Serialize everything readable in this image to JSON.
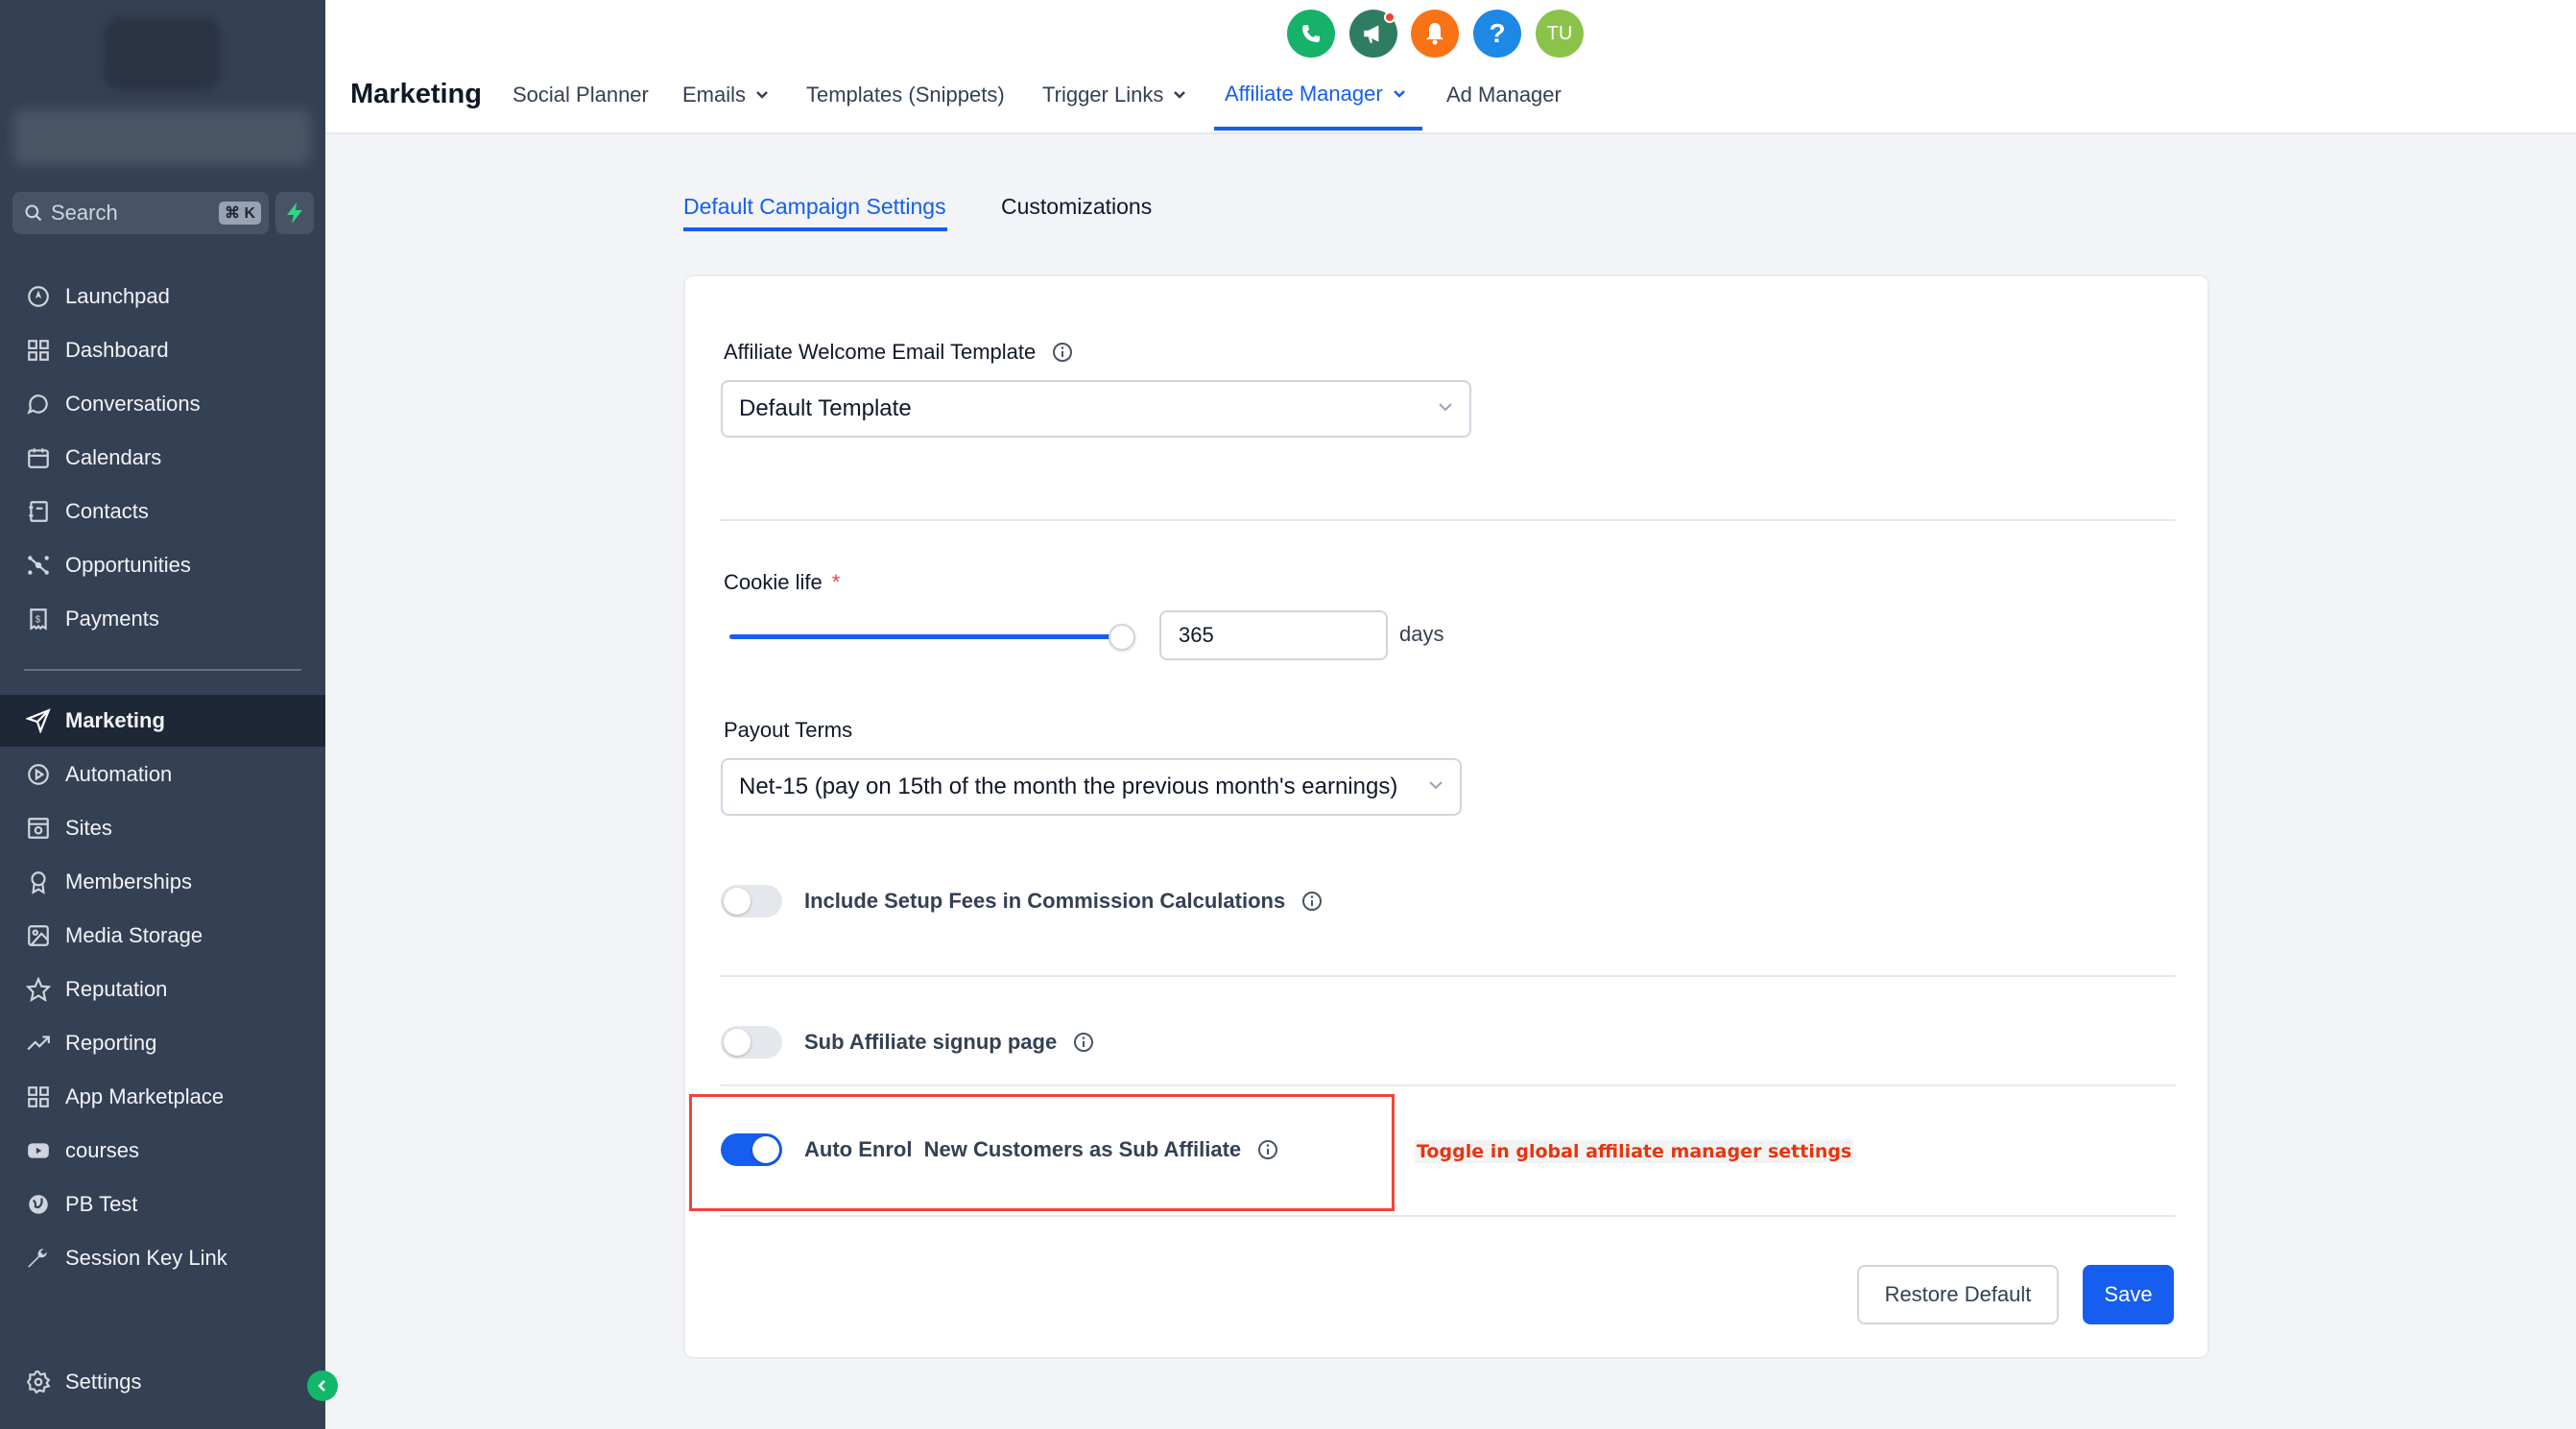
{
  "sidebar": {
    "search_placeholder": "Search",
    "search_shortcut": "⌘ K",
    "items": [
      {
        "label": "Launchpad",
        "icon": "launchpad-icon"
      },
      {
        "label": "Dashboard",
        "icon": "dashboard-icon"
      },
      {
        "label": "Conversations",
        "icon": "chat-icon"
      },
      {
        "label": "Calendars",
        "icon": "calendar-icon"
      },
      {
        "label": "Contacts",
        "icon": "contacts-icon"
      },
      {
        "label": "Opportunities",
        "icon": "opportunities-icon"
      },
      {
        "label": "Payments",
        "icon": "payments-icon"
      },
      {
        "label": "Marketing",
        "icon": "send-icon",
        "active": true
      },
      {
        "label": "Automation",
        "icon": "automation-icon"
      },
      {
        "label": "Sites",
        "icon": "sites-icon"
      },
      {
        "label": "Memberships",
        "icon": "award-icon"
      },
      {
        "label": "Media Storage",
        "icon": "image-icon"
      },
      {
        "label": "Reputation",
        "icon": "star-icon"
      },
      {
        "label": "Reporting",
        "icon": "trend-icon"
      },
      {
        "label": "App Marketplace",
        "icon": "grid-icon"
      },
      {
        "label": "courses",
        "icon": "video-icon"
      },
      {
        "label": "PB Test",
        "icon": "globe-icon"
      },
      {
        "label": "Session Key Link",
        "icon": "wrench-icon"
      }
    ],
    "settings_label": "Settings"
  },
  "topbar": {
    "title": "Marketing",
    "nav": [
      {
        "label": "Social Planner"
      },
      {
        "label": "Emails",
        "dropdown": true
      },
      {
        "label": "Templates (Snippets)"
      },
      {
        "label": "Trigger Links",
        "dropdown": true
      },
      {
        "label": "Affiliate Manager",
        "dropdown": true,
        "active": true
      },
      {
        "label": "Ad Manager"
      }
    ],
    "avatar_initials": "TU",
    "icon_colors": {
      "phone": "#17b26a",
      "announce": "#2e7d61",
      "bell": "#f97316",
      "help": "#1e88e5",
      "avatar": "#8bc34a"
    }
  },
  "subtabs": [
    {
      "label": "Default Campaign Settings",
      "active": true
    },
    {
      "label": "Customizations"
    }
  ],
  "form": {
    "welcome_email": {
      "label": "Affiliate Welcome Email Template",
      "value": "Default Template"
    },
    "cookie_life": {
      "label": "Cookie life",
      "required_mark": "*",
      "value": "365",
      "unit": "days",
      "slider_fraction": 1.0
    },
    "payout_terms": {
      "label": "Payout Terms",
      "value": "Net-15 (pay on 15th of the month the previous month's earnings)"
    },
    "toggles": [
      {
        "label": "Include Setup Fees in Commission Calculations",
        "on": false
      },
      {
        "label": "Sub Affiliate signup page",
        "on": false
      },
      {
        "label": "Auto Enrol  New Customers as Sub Affiliate",
        "on": true
      }
    ],
    "annotation": "Toggle in global affiliate manager settings",
    "restore_label": "Restore Default",
    "save_label": "Save"
  }
}
